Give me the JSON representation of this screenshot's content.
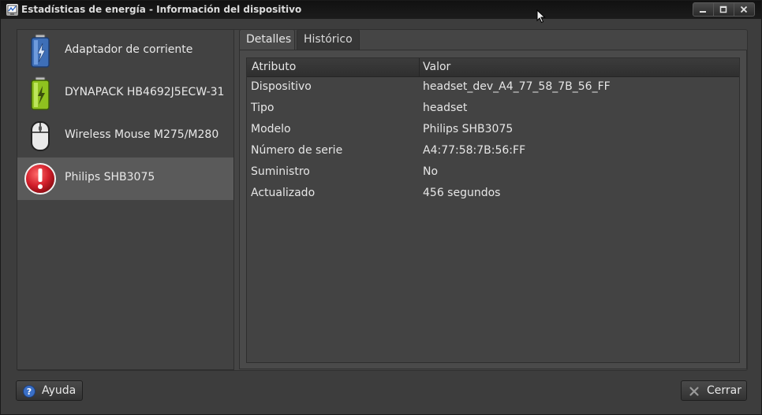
{
  "window": {
    "title": "Estadísticas de energía - Información del dispositivo"
  },
  "devices": [
    {
      "label": "Adaptador de corriente",
      "icon": "power-adapter-icon",
      "selected": false
    },
    {
      "label": "DYNAPACK HB4692J5ECW-31",
      "icon": "battery-charging-icon",
      "selected": false
    },
    {
      "label": "Wireless Mouse M275/M280",
      "icon": "mouse-icon",
      "selected": false
    },
    {
      "label": "Philips SHB3075",
      "icon": "warning-icon",
      "selected": true
    }
  ],
  "tabs": [
    {
      "label": "Detalles",
      "active": true
    },
    {
      "label": "Histórico",
      "active": false
    }
  ],
  "table": {
    "headers": [
      "Atributo",
      "Valor"
    ],
    "rows": [
      [
        "Dispositivo",
        "headset_dev_A4_77_58_7B_56_FF"
      ],
      [
        "Tipo",
        "headset"
      ],
      [
        "Modelo",
        "Philips SHB3075"
      ],
      [
        "Número de serie",
        "A4:77:58:7B:56:FF"
      ],
      [
        "Suministro",
        "No"
      ],
      [
        "Actualizado",
        "456 segundos"
      ]
    ]
  },
  "buttons": {
    "help": "Ayuda",
    "close": "Cerrar"
  },
  "colors": {
    "selection": "#5a5a5a",
    "warning": "#d21f2b",
    "battery_green": "#9bd12a",
    "adapter_blue": "#4d7fc4"
  }
}
